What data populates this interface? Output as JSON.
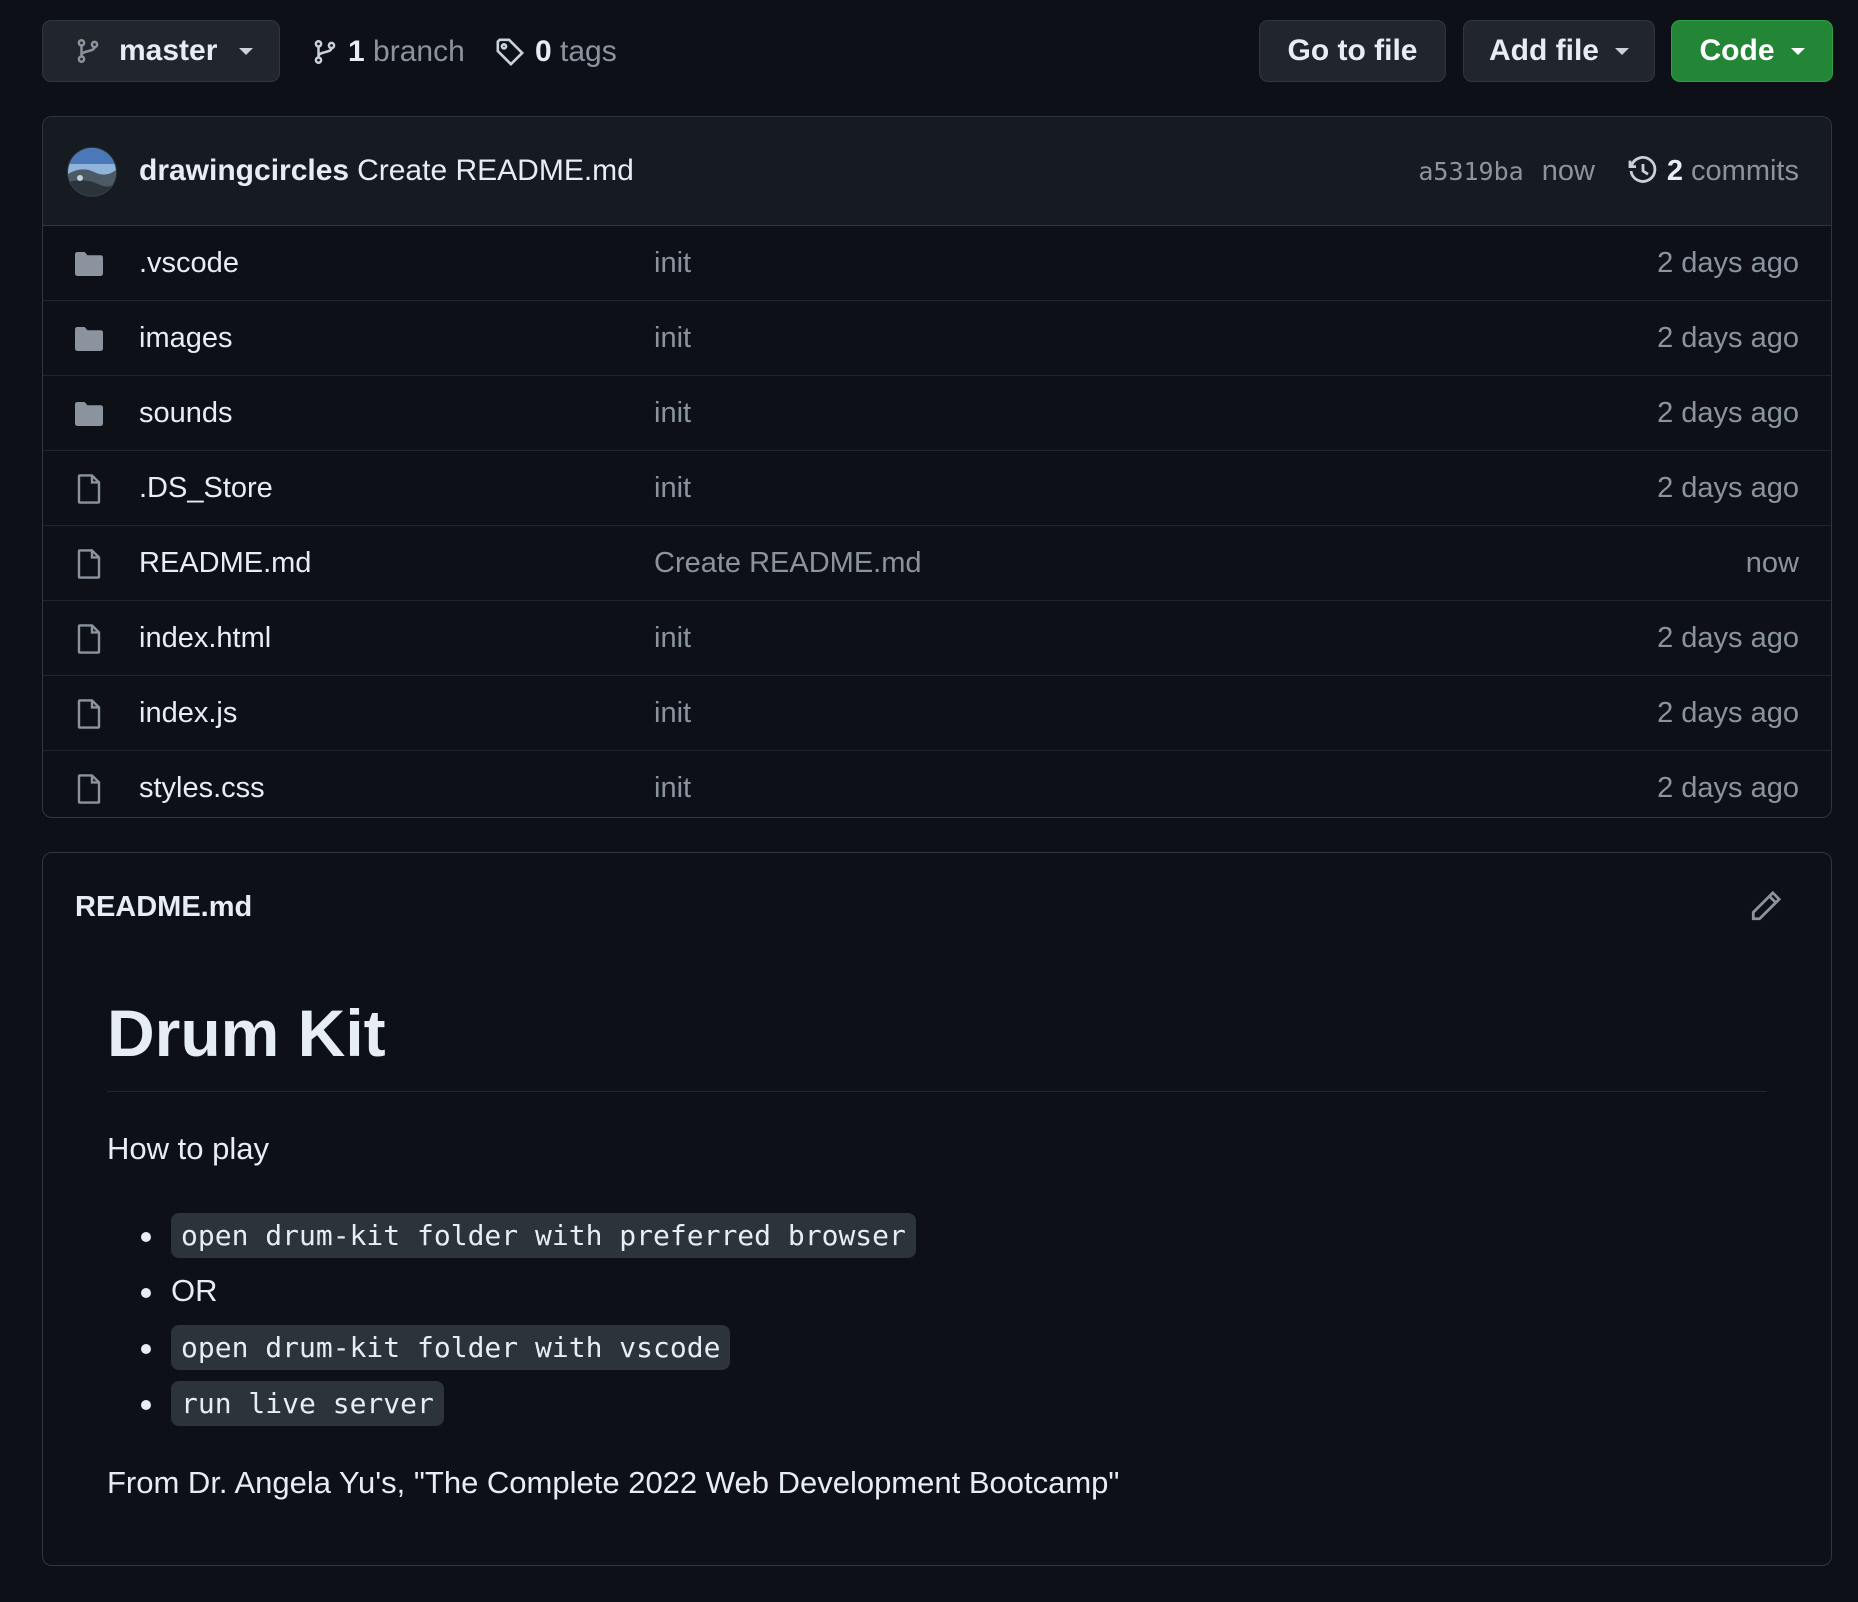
{
  "toolbar": {
    "branch_name": "master",
    "branches_count": "1",
    "branches_label": "branch",
    "tags_count": "0",
    "tags_label": "tags",
    "go_to_file": "Go to file",
    "add_file": "Add file",
    "code": "Code"
  },
  "commit": {
    "author": "drawingcircles",
    "message": "Create README.md",
    "sha": "a5319ba",
    "time": "now",
    "commits_count": "2",
    "commits_label": "commits"
  },
  "files": [
    {
      "type": "folder",
      "name": ".vscode",
      "message": "init",
      "age": "2 days ago"
    },
    {
      "type": "folder",
      "name": "images",
      "message": "init",
      "age": "2 days ago"
    },
    {
      "type": "folder",
      "name": "sounds",
      "message": "init",
      "age": "2 days ago"
    },
    {
      "type": "file",
      "name": ".DS_Store",
      "message": "init",
      "age": "2 days ago"
    },
    {
      "type": "file",
      "name": "README.md",
      "message": "Create README.md",
      "age": "now"
    },
    {
      "type": "file",
      "name": "index.html",
      "message": "init",
      "age": "2 days ago"
    },
    {
      "type": "file",
      "name": "index.js",
      "message": "init",
      "age": "2 days ago"
    },
    {
      "type": "file",
      "name": "styles.css",
      "message": "init",
      "age": "2 days ago"
    }
  ],
  "readme": {
    "filename": "README.md",
    "heading": "Drum Kit",
    "intro": "How to play",
    "steps": [
      {
        "text": "open drum-kit folder with preferred browser",
        "code": true
      },
      {
        "text": "OR",
        "code": false
      },
      {
        "text": "open drum-kit folder with vscode",
        "code": true
      },
      {
        "text": "run live server",
        "code": true
      }
    ],
    "credit": "From Dr. Angela Yu's, \"The Complete 2022 Web Development Bootcamp\""
  },
  "colors": {
    "background": "#0d1117",
    "code_button": "#238636",
    "border": "#30363d",
    "muted_text": "#8b949e"
  },
  "icons": [
    "git-branch-icon",
    "tag-icon",
    "history-icon",
    "folder-icon",
    "file-icon",
    "pencil-icon",
    "caret-down-icon"
  ]
}
